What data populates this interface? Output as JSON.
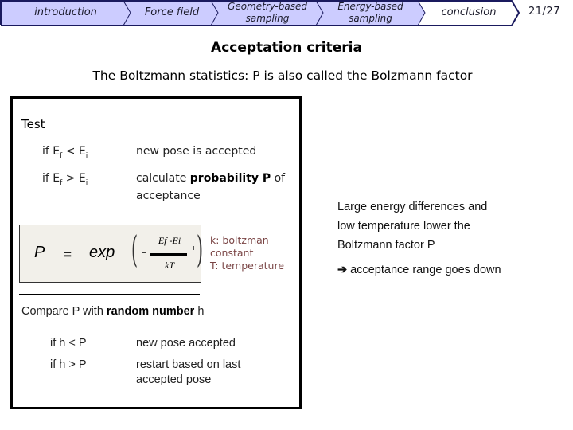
{
  "nav": {
    "items": [
      {
        "label": "introduction",
        "state": "visited"
      },
      {
        "label": "Force field",
        "state": "visited"
      },
      {
        "label": "Geometry-based sampling",
        "line1": "Geometry-based",
        "line2": "sampling",
        "state": "visited"
      },
      {
        "label": "Energy-based sampling",
        "line1": "Energy-based",
        "line2": "sampling",
        "state": "current"
      },
      {
        "label": "conclusion",
        "state": "upcoming"
      }
    ],
    "page_number": "21/27",
    "colors": {
      "filled": "#ccccff",
      "border": "#1a1a5e",
      "unfilled": "#ffffff"
    }
  },
  "slide": {
    "title": "Acceptation criteria",
    "subtitle": "The Boltzmann statistics: P is also called the Bolzmann factor",
    "test_label": "Test",
    "conditions": [
      {
        "prefix": "if E",
        "sub1": "f",
        "op": " < E",
        "sub2": "i",
        "result_text": "new pose is accepted"
      },
      {
        "prefix": "if E",
        "sub1": "f",
        "op": " >  E",
        "sub2": "i",
        "result_pre": "calculate ",
        "result_bold": "probability P",
        "result_post": " of",
        "result_line2": "acceptance"
      }
    ],
    "formula": {
      "lhs": "P",
      "equals": "=",
      "func": "exp",
      "minus": "–",
      "numerator": "Ef -Ei",
      "denominator": "kT",
      "background": "#f2f0ea"
    },
    "constants": {
      "line1": "k: boltzman",
      "line2": "constant",
      "line3": "T: temperature",
      "color": "#7a4545"
    },
    "compare": {
      "pre": "Compare P with ",
      "bold": "random number",
      "post": " h"
    },
    "h_conditions": [
      {
        "cond": "if h < P",
        "result_line1": "new pose accepted"
      },
      {
        "cond": "if h > P",
        "result_line1": "restart based on last",
        "result_line2": "accepted pose"
      }
    ],
    "note": {
      "line1": "Large energy differences and",
      "line2": "low temperature lower the",
      "line3": "Boltzmann factor P",
      "arrow": "➔",
      "conclusion": "acceptance range goes down"
    }
  }
}
